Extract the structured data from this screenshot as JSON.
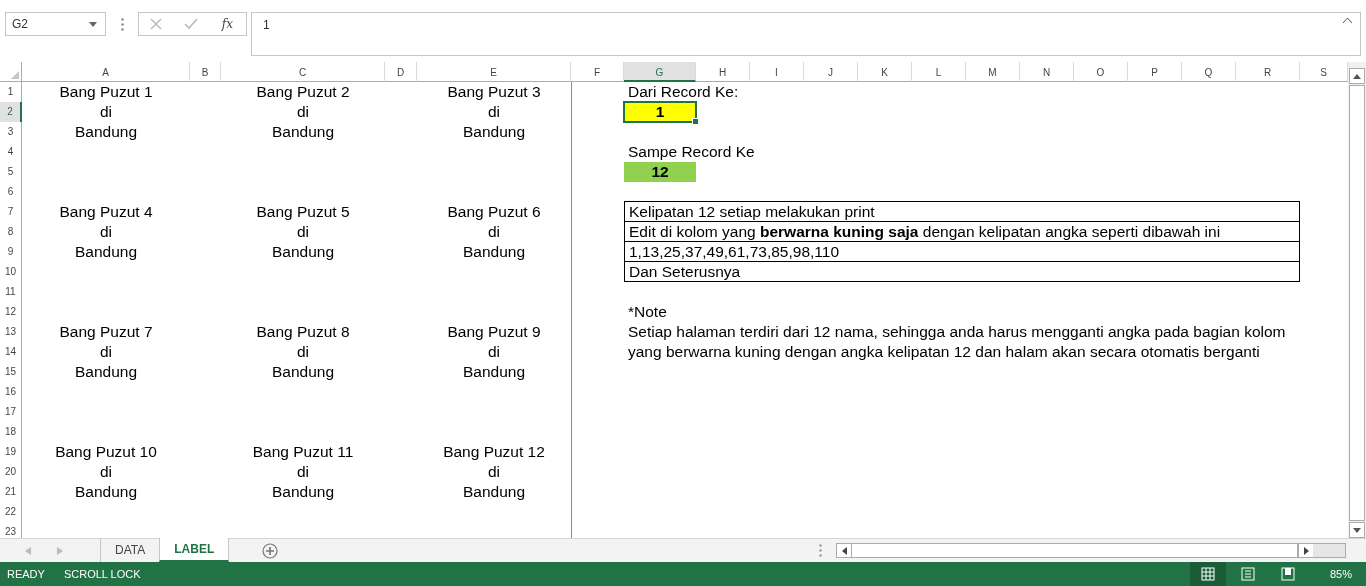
{
  "formula_bar": {
    "name_box": "G2",
    "function_label": "fx",
    "value": "1"
  },
  "sheet": {
    "columns": [
      {
        "label": "A",
        "selected": false
      },
      {
        "label": "B",
        "selected": false
      },
      {
        "label": "C",
        "selected": false
      },
      {
        "label": "D",
        "selected": false
      },
      {
        "label": "E",
        "selected": false
      },
      {
        "label": "F",
        "selected": false
      },
      {
        "label": "G",
        "selected": true
      },
      {
        "label": "H",
        "selected": false
      },
      {
        "label": "I",
        "selected": false
      },
      {
        "label": "J",
        "selected": false
      },
      {
        "label": "K",
        "selected": false
      },
      {
        "label": "L",
        "selected": false
      },
      {
        "label": "M",
        "selected": false
      },
      {
        "label": "N",
        "selected": false
      },
      {
        "label": "O",
        "selected": false
      },
      {
        "label": "P",
        "selected": false
      },
      {
        "label": "Q",
        "selected": false
      },
      {
        "label": "R",
        "selected": false
      },
      {
        "label": "S",
        "selected": false
      }
    ],
    "rows": [
      {
        "label": "1",
        "selected": false,
        "cells": [
          {
            "text": "Bang Puzut 1",
            "kind": "centered"
          },
          null,
          {
            "text": "Bang Puzut 2",
            "kind": "centered"
          },
          null,
          {
            "text": "Bang Puzut 3",
            "kind": "centered"
          },
          null,
          {
            "text": "Dari Record Ke:",
            "kind": "left"
          }
        ]
      },
      {
        "label": "2",
        "selected": true,
        "cells": [
          {
            "text": "di",
            "kind": "centered"
          },
          null,
          {
            "text": "di",
            "kind": "centered"
          },
          null,
          {
            "text": "di",
            "kind": "centered"
          },
          null,
          {
            "text": "1",
            "kind": "centered",
            "bold": true,
            "color": "#ffff00"
          }
        ]
      },
      {
        "label": "3",
        "selected": false,
        "cells": [
          {
            "text": "Bandung",
            "kind": "centered"
          },
          null,
          {
            "text": "Bandung",
            "kind": "centered"
          },
          null,
          {
            "text": "Bandung",
            "kind": "centered"
          }
        ]
      },
      {
        "label": "4",
        "selected": false,
        "cells": [
          null,
          null,
          null,
          null,
          null,
          null,
          {
            "text": "Sampe Record Ke",
            "kind": "left"
          }
        ]
      },
      {
        "label": "5",
        "selected": false,
        "cells": [
          null,
          null,
          null,
          null,
          null,
          null,
          {
            "text": "12",
            "kind": "centered",
            "bold": true,
            "color": "#92d050"
          }
        ]
      },
      {
        "label": "6",
        "selected": false,
        "cells": []
      },
      {
        "label": "7",
        "selected": false,
        "cells": [
          {
            "text": "Bang Puzut 4",
            "kind": "centered"
          },
          null,
          {
            "text": "Bang Puzut 5",
            "kind": "centered"
          },
          null,
          {
            "text": "Bang Puzut 6",
            "kind": "centered"
          },
          null,
          {
            "text": "Kelipatan 12 setiap melakukan print",
            "kind": "left",
            "border": true
          }
        ]
      },
      {
        "label": "8",
        "selected": false,
        "cells": [
          {
            "text": "di",
            "kind": "centered"
          },
          null,
          {
            "text": "di",
            "kind": "centered"
          },
          null,
          {
            "text": "di",
            "kind": "centered"
          },
          null,
          {
            "text": "Edit di kolom yang **berwarna kuning saja** dengan kelipatan angka seperti dibawah ini",
            "kind": "left",
            "border": true
          }
        ]
      },
      {
        "label": "9",
        "selected": false,
        "cells": [
          {
            "text": "Bandung",
            "kind": "centered"
          },
          null,
          {
            "text": "Bandung",
            "kind": "centered"
          },
          null,
          {
            "text": "Bandung",
            "kind": "centered"
          },
          null,
          {
            "text": "1,13,25,37,49,61,73,85,98,110",
            "kind": "left",
            "border": true
          }
        ]
      },
      {
        "label": "10",
        "selected": false,
        "cells": [
          null,
          null,
          null,
          null,
          null,
          null,
          {
            "text": "Dan Seterusnya",
            "kind": "left",
            "border": true
          }
        ]
      },
      {
        "label": "11",
        "selected": false,
        "cells": []
      },
      {
        "label": "12",
        "selected": false,
        "cells": [
          null,
          null,
          null,
          null,
          null,
          null,
          {
            "text": "*Note",
            "kind": "left"
          }
        ]
      },
      {
        "label": "13",
        "selected": false,
        "cells": [
          {
            "text": "Bang Puzut 7",
            "kind": "centered"
          },
          null,
          {
            "text": "Bang Puzut 8",
            "kind": "centered"
          },
          null,
          {
            "text": "Bang Puzut 9",
            "kind": "centered"
          },
          null,
          {
            "text": "Setiap halaman terdiri dari 12 nama, sehingga anda harus mengganti angka pada bagian kolom",
            "kind": "left"
          }
        ]
      },
      {
        "label": "14",
        "selected": false,
        "cells": [
          {
            "text": "di",
            "kind": "centered"
          },
          null,
          {
            "text": "di",
            "kind": "centered"
          },
          null,
          {
            "text": "di",
            "kind": "centered"
          },
          null,
          {
            "text": "yang berwarna kuning dengan angka kelipatan 12 dan halam akan secara otomatis berganti",
            "kind": "left"
          }
        ]
      },
      {
        "label": "15",
        "selected": false,
        "cells": [
          {
            "text": "Bandung",
            "kind": "centered"
          },
          null,
          {
            "text": "Bandung",
            "kind": "centered"
          },
          null,
          {
            "text": "Bandung",
            "kind": "centered"
          }
        ]
      },
      {
        "label": "16",
        "selected": false,
        "cells": []
      },
      {
        "label": "17",
        "selected": false,
        "cells": []
      },
      {
        "label": "18",
        "selected": false,
        "cells": []
      },
      {
        "label": "19",
        "selected": false,
        "cells": [
          {
            "text": "Bang Puzut 10",
            "kind": "centered"
          },
          null,
          {
            "text": "Bang Puzut 11",
            "kind": "centered"
          },
          null,
          {
            "text": "Bang Puzut 12",
            "kind": "centered"
          }
        ]
      },
      {
        "label": "20",
        "selected": false,
        "cells": [
          {
            "text": "di",
            "kind": "centered"
          },
          null,
          {
            "text": "di",
            "kind": "centered"
          },
          null,
          {
            "text": "di",
            "kind": "centered"
          }
        ]
      },
      {
        "label": "21",
        "selected": false,
        "cells": [
          {
            "text": "Bandung",
            "kind": "centered"
          },
          null,
          {
            "text": "Bandung",
            "kind": "centered"
          },
          null,
          {
            "text": "Bandung",
            "kind": "centered"
          }
        ]
      },
      {
        "label": "22",
        "selected": false,
        "cells": []
      },
      {
        "label": "23",
        "selected": false,
        "cells": []
      }
    ]
  },
  "sheet_tabs": [
    {
      "label": "DATA",
      "selected": false
    },
    {
      "label": "LABEL",
      "selected": true
    }
  ],
  "status_bar": {
    "items": [
      "READY",
      "SCROLL LOCK"
    ],
    "views": [
      {
        "kind": "normal",
        "selected": true
      },
      {
        "kind": "page-layout",
        "selected": false
      },
      {
        "kind": "page-break",
        "selected": false
      }
    ],
    "zoom": "85%"
  }
}
